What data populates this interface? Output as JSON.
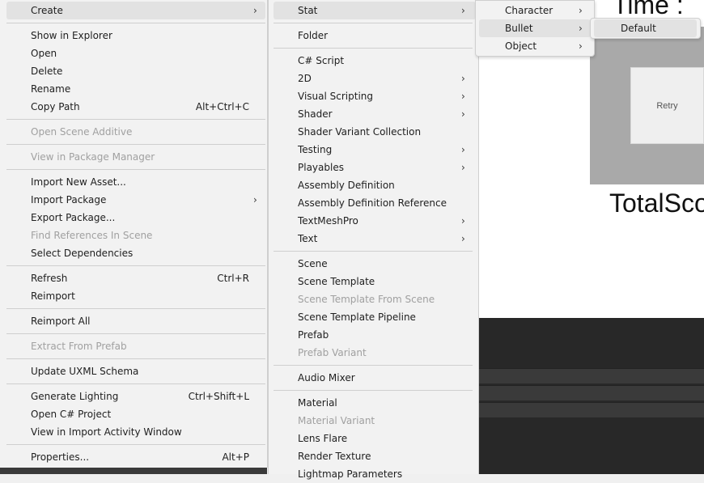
{
  "background": {
    "time_label": "Time :",
    "total_label": "TotalSco",
    "retry_label": "Retry"
  },
  "main_menu": {
    "items": [
      {
        "label": "Create"
      },
      {
        "label": "Show in Explorer"
      },
      {
        "label": "Open"
      },
      {
        "label": "Delete"
      },
      {
        "label": "Rename"
      },
      {
        "label": "Copy Path",
        "shortcut": "Alt+Ctrl+C"
      },
      {
        "label": "Open Scene Additive"
      },
      {
        "label": "View in Package Manager"
      },
      {
        "label": "Import New Asset..."
      },
      {
        "label": "Import Package"
      },
      {
        "label": "Export Package..."
      },
      {
        "label": "Find References In Scene"
      },
      {
        "label": "Select Dependencies"
      },
      {
        "label": "Refresh",
        "shortcut": "Ctrl+R"
      },
      {
        "label": "Reimport"
      },
      {
        "label": "Reimport All"
      },
      {
        "label": "Extract From Prefab"
      },
      {
        "label": "Update UXML Schema"
      },
      {
        "label": "Generate Lighting",
        "shortcut": "Ctrl+Shift+L"
      },
      {
        "label": "Open C# Project"
      },
      {
        "label": "View in Import Activity Window"
      },
      {
        "label": "Properties...",
        "shortcut": "Alt+P"
      }
    ]
  },
  "create_menu": {
    "items": [
      {
        "label": "Stat"
      },
      {
        "label": "Folder"
      },
      {
        "label": "C# Script"
      },
      {
        "label": "2D"
      },
      {
        "label": "Visual Scripting"
      },
      {
        "label": "Shader"
      },
      {
        "label": "Shader Variant Collection"
      },
      {
        "label": "Testing"
      },
      {
        "label": "Playables"
      },
      {
        "label": "Assembly Definition"
      },
      {
        "label": "Assembly Definition Reference"
      },
      {
        "label": "TextMeshPro"
      },
      {
        "label": "Text"
      },
      {
        "label": "Scene"
      },
      {
        "label": "Scene Template"
      },
      {
        "label": "Scene Template From Scene"
      },
      {
        "label": "Scene Template Pipeline"
      },
      {
        "label": "Prefab"
      },
      {
        "label": "Prefab Variant"
      },
      {
        "label": "Audio Mixer"
      },
      {
        "label": "Material"
      },
      {
        "label": "Material Variant"
      },
      {
        "label": "Lens Flare"
      },
      {
        "label": "Render Texture"
      },
      {
        "label": "Lightmap Parameters"
      }
    ]
  },
  "stat_menu": {
    "items": [
      {
        "label": "Character"
      },
      {
        "label": "Bullet"
      },
      {
        "label": "Object"
      }
    ]
  },
  "bullet_menu": {
    "items": [
      {
        "label": "Default"
      }
    ]
  },
  "icons": {
    "submenu_arrow": "chevron-right-icon"
  }
}
